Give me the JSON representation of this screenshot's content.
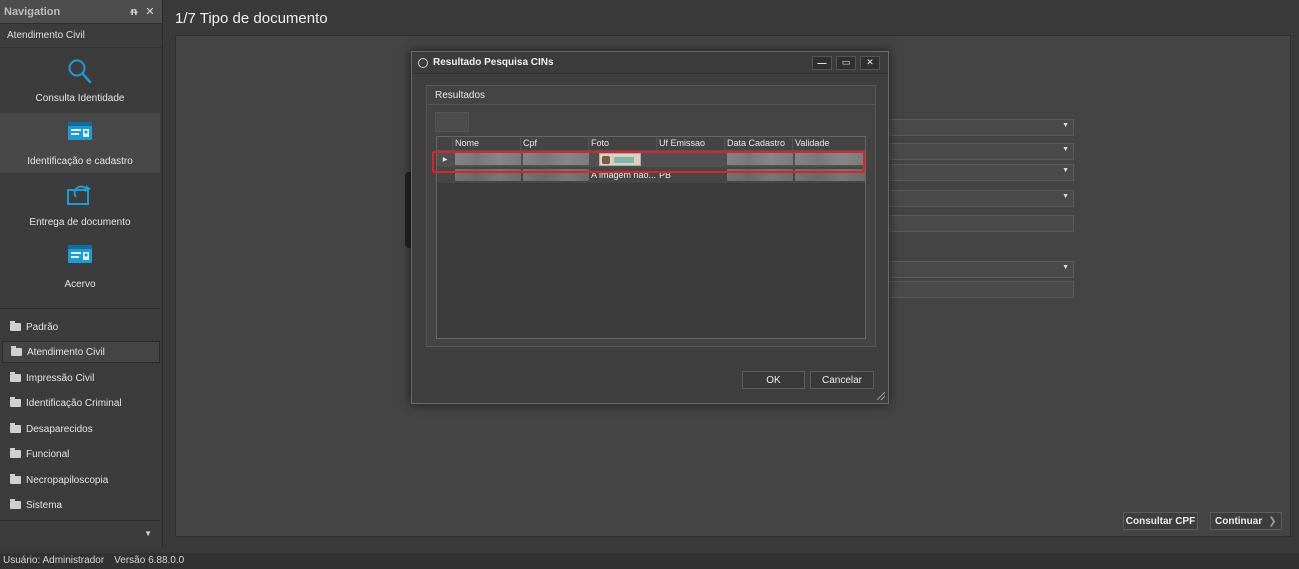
{
  "navigation": {
    "header_title": "Navigation",
    "pin_glyph": "ᵰ",
    "close_glyph": "✕",
    "group_title": "Atendimento Civil",
    "tiles": [
      {
        "label": "Consulta Identidade",
        "icon": "search-icon"
      },
      {
        "label": "Identificação e cadastro",
        "icon": "id-card-icon"
      },
      {
        "label": "Entrega de documento",
        "icon": "document-delivery-icon"
      },
      {
        "label": "Acervo",
        "icon": "archive-card-icon"
      }
    ],
    "items": [
      {
        "label": "Padrão"
      },
      {
        "label": "Atendimento Civil"
      },
      {
        "label": "Impressão Civil"
      },
      {
        "label": "Identificação Criminal"
      },
      {
        "label": "Desaparecidos"
      },
      {
        "label": "Funcional"
      },
      {
        "label": "Necropapiloscopia"
      },
      {
        "label": "Sistema"
      }
    ],
    "more_glyph": "▼"
  },
  "main": {
    "title": "1/7 Tipo de documento",
    "consult_cpf_label": "Consultar CPF",
    "continue_label": "Continuar",
    "continue_glyph": "❯"
  },
  "modal": {
    "title": "Resultado Pesquisa CINs",
    "minimize_glyph": "—",
    "maximize_glyph": "▭",
    "close_glyph": "✕",
    "group_label": "Resultados",
    "columns": [
      "Nome",
      "Cpf",
      "Foto",
      "Uf Emissao",
      "Data Cadastro",
      "Validade"
    ],
    "rows": [
      {
        "indicator": "▶",
        "foto": "",
        "uf": ""
      },
      {
        "indicator": "",
        "foto": "A imagem não...",
        "uf": "PB"
      }
    ],
    "ok_label": "OK",
    "cancel_label": "Cancelar"
  },
  "status": {
    "user": "Usuário: Administrador",
    "version": "Versão 6.88.0.0"
  },
  "colors": {
    "highlight": "#e0212b",
    "icon_blue": "#1c9bd6"
  }
}
